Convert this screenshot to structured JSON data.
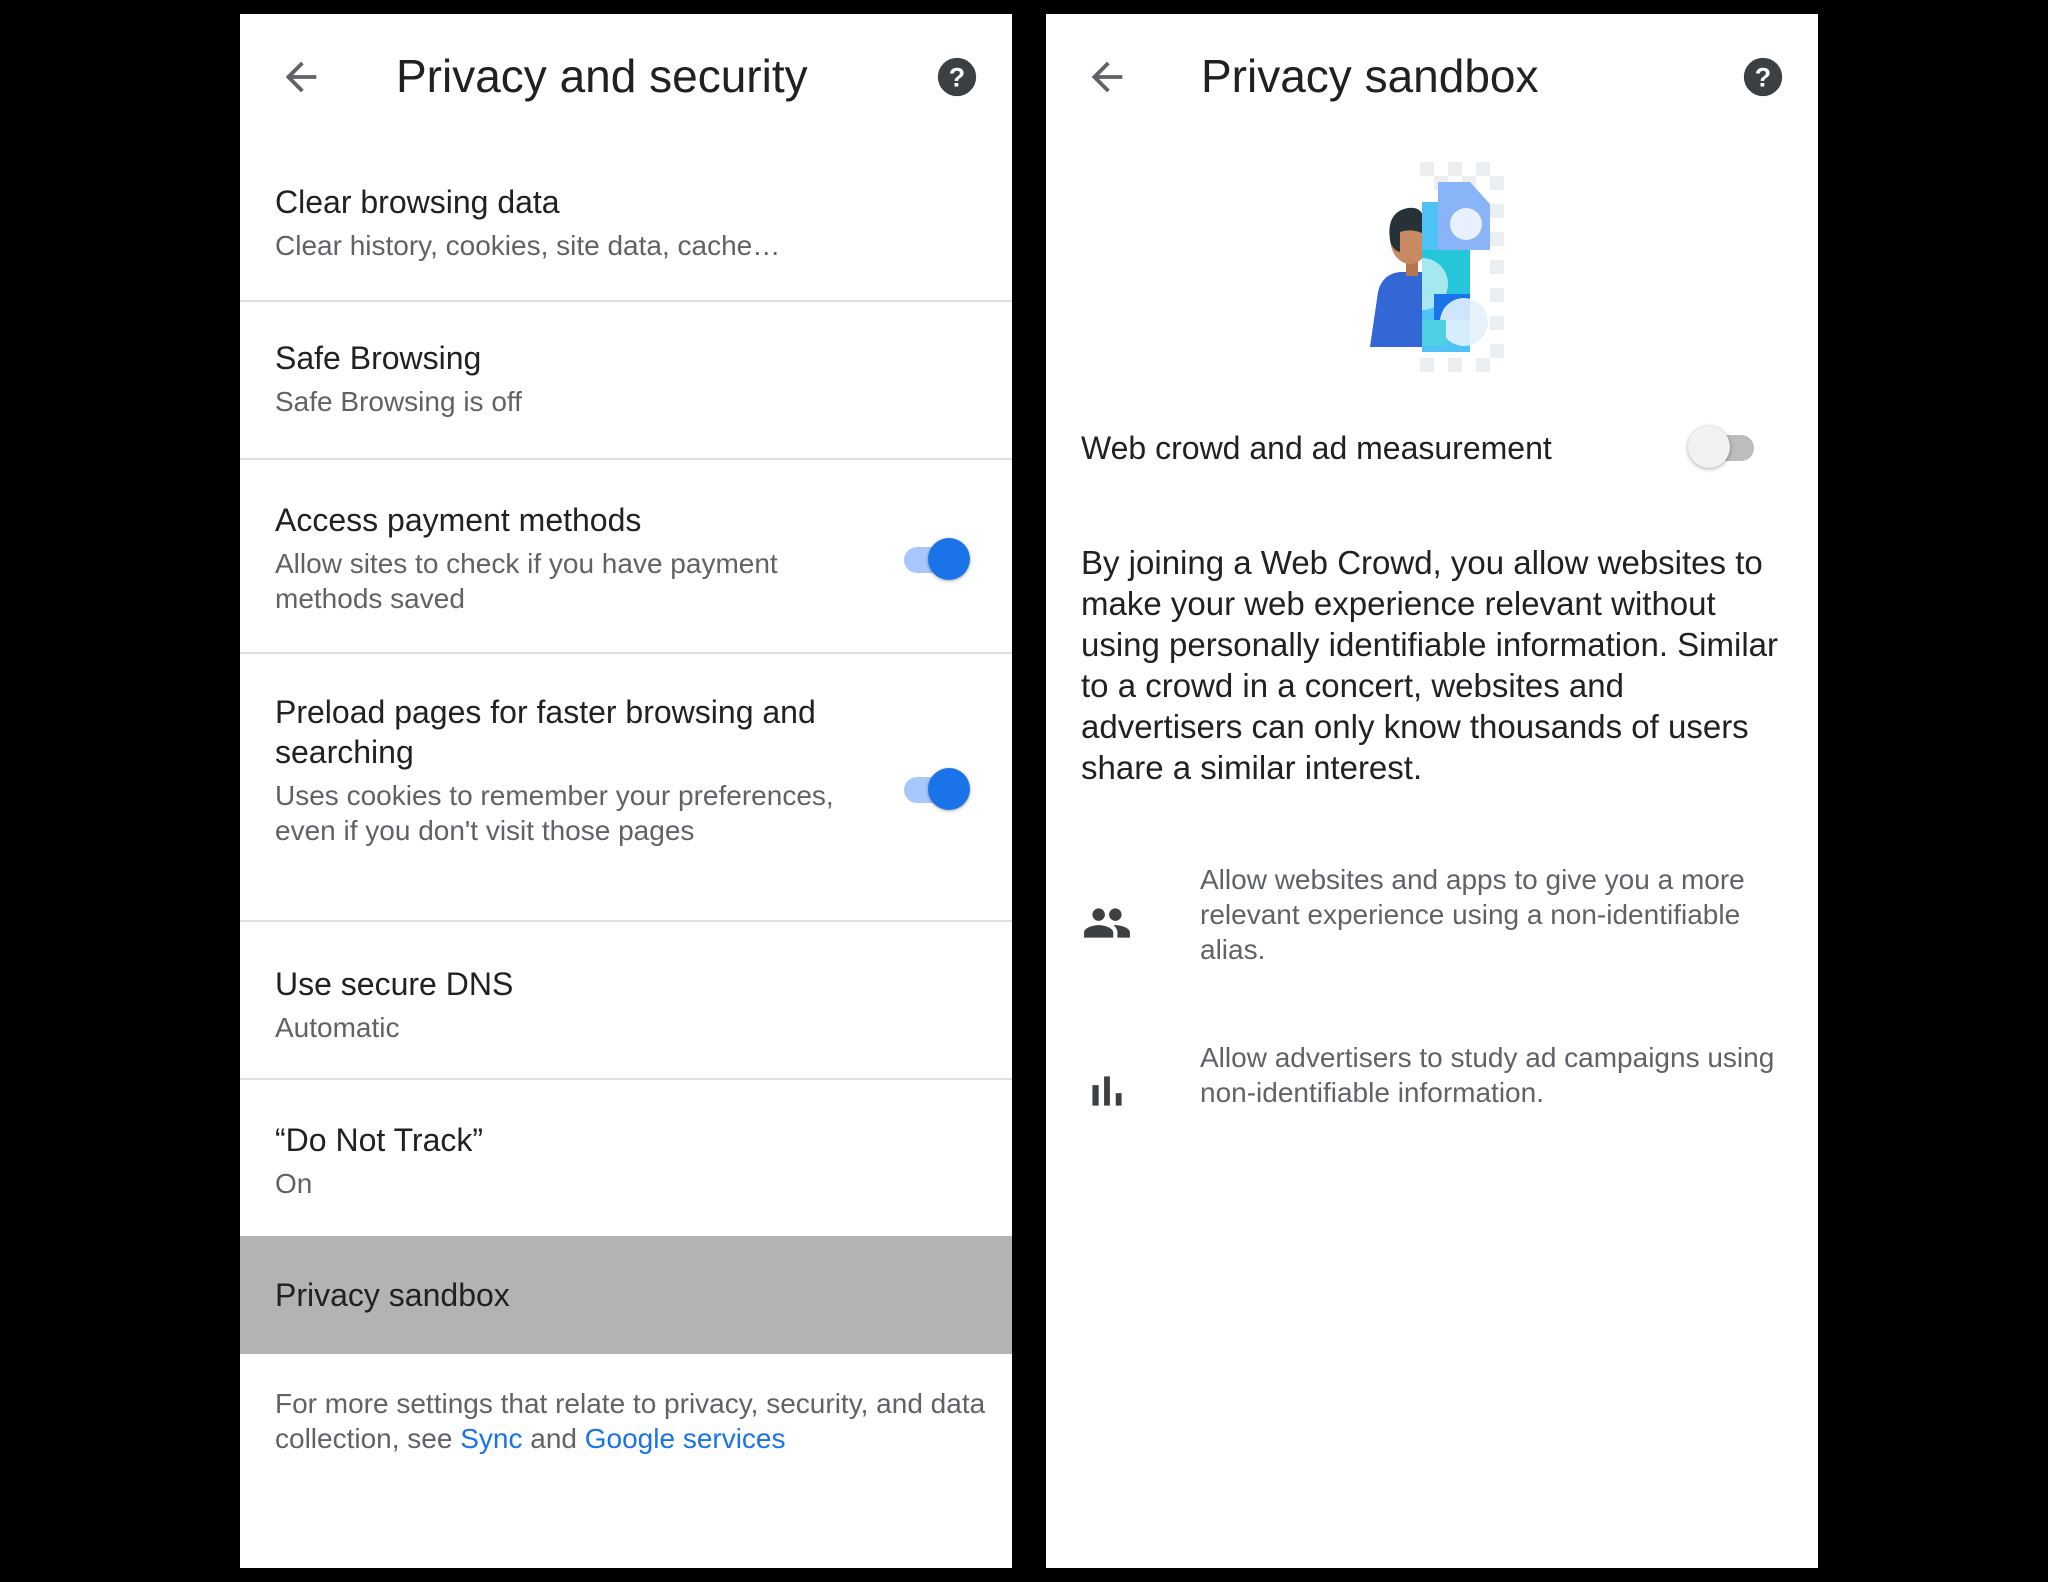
{
  "left": {
    "title": "Privacy and security",
    "items": [
      {
        "title": "Clear browsing data",
        "subtitle": "Clear history, cookies, site data, cache…"
      },
      {
        "title": "Safe Browsing",
        "subtitle": "Safe Browsing is off"
      },
      {
        "title": "Access payment methods",
        "subtitle": "Allow sites to check if you have payment methods saved",
        "toggle": "on"
      },
      {
        "title": "Preload pages for faster browsing and searching",
        "subtitle": "Uses cookies to remember your preferences, even if you don't visit those pages",
        "toggle": "on"
      },
      {
        "title": "Use secure DNS",
        "subtitle": "Automatic"
      },
      {
        "title": "“Do Not Track”",
        "subtitle": "On"
      },
      {
        "title": "Privacy sandbox"
      }
    ],
    "footer": {
      "text_before": "For more settings that relate to privacy, security, and data collection, see ",
      "link1": "Sync",
      "text_mid": " and ",
      "link2": "Google services"
    }
  },
  "right": {
    "title": "Privacy sandbox",
    "setting_label": "Web crowd and ad measurement",
    "setting_toggle": "off",
    "description": "By joining a Web Crowd, you allow websites to make your web experience relevant without using personally identifiable information. Similar to a crowd in a concert, websites and advertisers can only know thousands of users share a similar interest.",
    "features": [
      {
        "icon": "people-icon",
        "text": "Allow websites and apps to give you a more relevant experience using a non-identifiable alias."
      },
      {
        "icon": "bar-chart-icon",
        "text": "Allow advertisers to study ad campaigns using non-identifiable information."
      }
    ]
  },
  "colors": {
    "accent": "#1a73e8",
    "highlight": "#b3b3b3",
    "secondary_text": "#5f6368"
  }
}
